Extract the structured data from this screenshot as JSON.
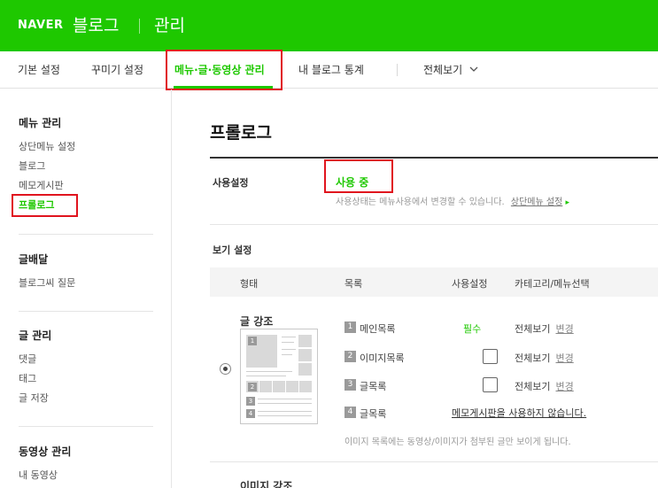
{
  "header": {
    "logo": "NAVER",
    "blog": "블로그",
    "manage": "관리",
    "brand_color": "#1ec800"
  },
  "tabs": [
    {
      "label": "기본 설정"
    },
    {
      "label": "꾸미기 설정"
    },
    {
      "label": "메뉴·글·동영상 관리",
      "active": true
    },
    {
      "label": "내 블로그 통계"
    },
    {
      "label": "전체보기",
      "icon": "chevron-down-icon"
    }
  ],
  "sidebar": {
    "sections": [
      {
        "title": "메뉴 관리",
        "items": [
          "상단메뉴 설정",
          "블로그",
          "메모게시판",
          "프롤로그"
        ],
        "active_index": 3
      },
      {
        "title": "글배달",
        "items": [
          "블로그씨 질문"
        ]
      },
      {
        "title": "글 관리",
        "items": [
          "댓글",
          "태그",
          "글 저장"
        ]
      },
      {
        "title": "동영상 관리",
        "items": [
          "내 동영상"
        ]
      }
    ]
  },
  "main": {
    "title": "프롤로그",
    "usage": {
      "label": "사용설정",
      "status": "사용 중",
      "note": "사용상태는 메뉴사용에서 변경할 수 있습니다.",
      "link": "상단메뉴 설정"
    },
    "view": {
      "label": "보기 설정",
      "columns": [
        "형태",
        "목록",
        "사용설정",
        "카테고리/메뉴선택"
      ],
      "layout_name": "글 강조",
      "thumb_numbers": [
        "1",
        "2",
        "3",
        "4"
      ],
      "rows": [
        {
          "num": "1",
          "label": "메인목록",
          "usage": "필수",
          "category": "전체보기",
          "change": "변경"
        },
        {
          "num": "2",
          "label": "이미지목록",
          "usage": "checkbox",
          "category": "전체보기",
          "change": "변경"
        },
        {
          "num": "3",
          "label": "글목록",
          "usage": "checkbox",
          "category": "전체보기",
          "change": "변경"
        },
        {
          "num": "4",
          "label": "글목록",
          "memo_link": "메모게시판을 사용하지 않습니다."
        }
      ],
      "foot_note": "이미지 목록에는 동영상/이미지가 첨부된 글만 보이게 됩니다.",
      "next_layout_name": "이미지 강조"
    }
  }
}
